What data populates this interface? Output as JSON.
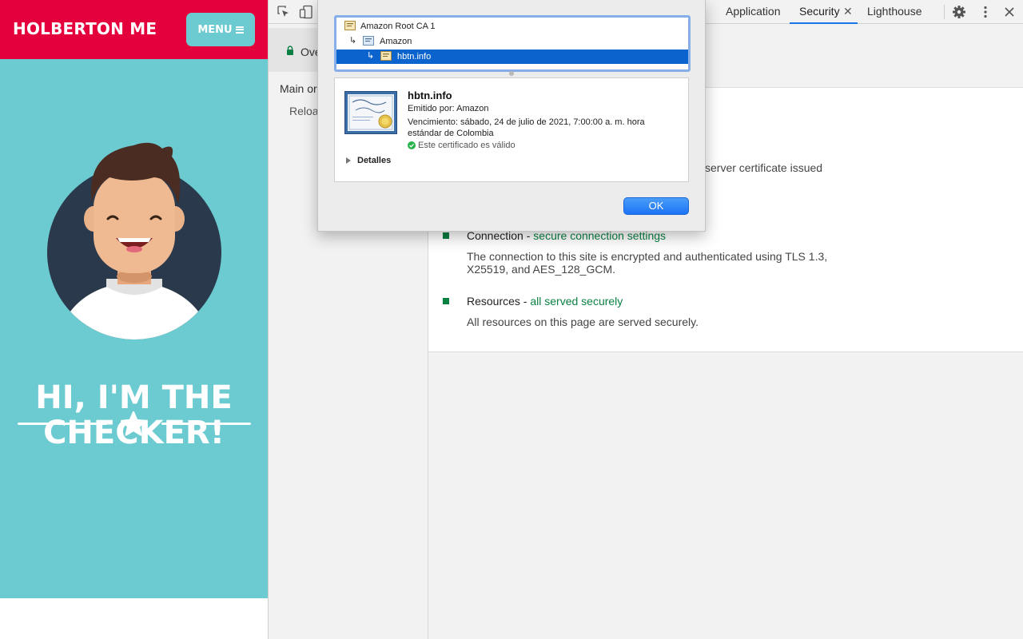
{
  "site": {
    "brand": "HOLBERTON ME",
    "menu_label": "MENU",
    "hero_title_line1": "HI, I'M THE",
    "hero_title_line2": "CHECKER!"
  },
  "devtools": {
    "tabs": {
      "application": "Application",
      "security": "Security",
      "lighthouse": "Lighthouse"
    },
    "sidebar": {
      "overview": "Ove",
      "main_origin": "Main ori",
      "reload": "Reloa"
    },
    "summary": {
      "certificate_fragment": "server certificate issued",
      "connection_title": "Connection - ",
      "connection_link": "secure connection settings",
      "connection_desc_line1": "The connection to this site is encrypted and authenticated using TLS 1.3,",
      "connection_desc_line2": "X25519, and AES_128_GCM.",
      "resources_title": "Resources - ",
      "resources_link": "all served securely",
      "resources_desc": "All resources on this page are served securely."
    },
    "colors": {
      "secure_green": "#0b8043",
      "active_tab": "#1a73e8"
    }
  },
  "certificate_dialog": {
    "chain": [
      {
        "label": "Amazon Root CA 1",
        "selected": false
      },
      {
        "label": "Amazon",
        "selected": false
      },
      {
        "label": "hbtn.info",
        "selected": true
      }
    ],
    "name": "hbtn.info",
    "issuer": "Emitido por: Amazon",
    "expiry": "Vencimiento: sábado, 24 de julio de 2021, 7:00:00 a. m. hora estándar de Colombia",
    "validity": "Este certificado es válido",
    "details_label": "Detalles",
    "ok_label": "OK"
  },
  "icons": [
    "inspect-icon",
    "device-toggle-icon",
    "gear-icon",
    "kebab-menu-icon",
    "close-icon",
    "lock-icon",
    "certificate-icon",
    "check-icon",
    "star-icon",
    "hamburger-icon"
  ]
}
